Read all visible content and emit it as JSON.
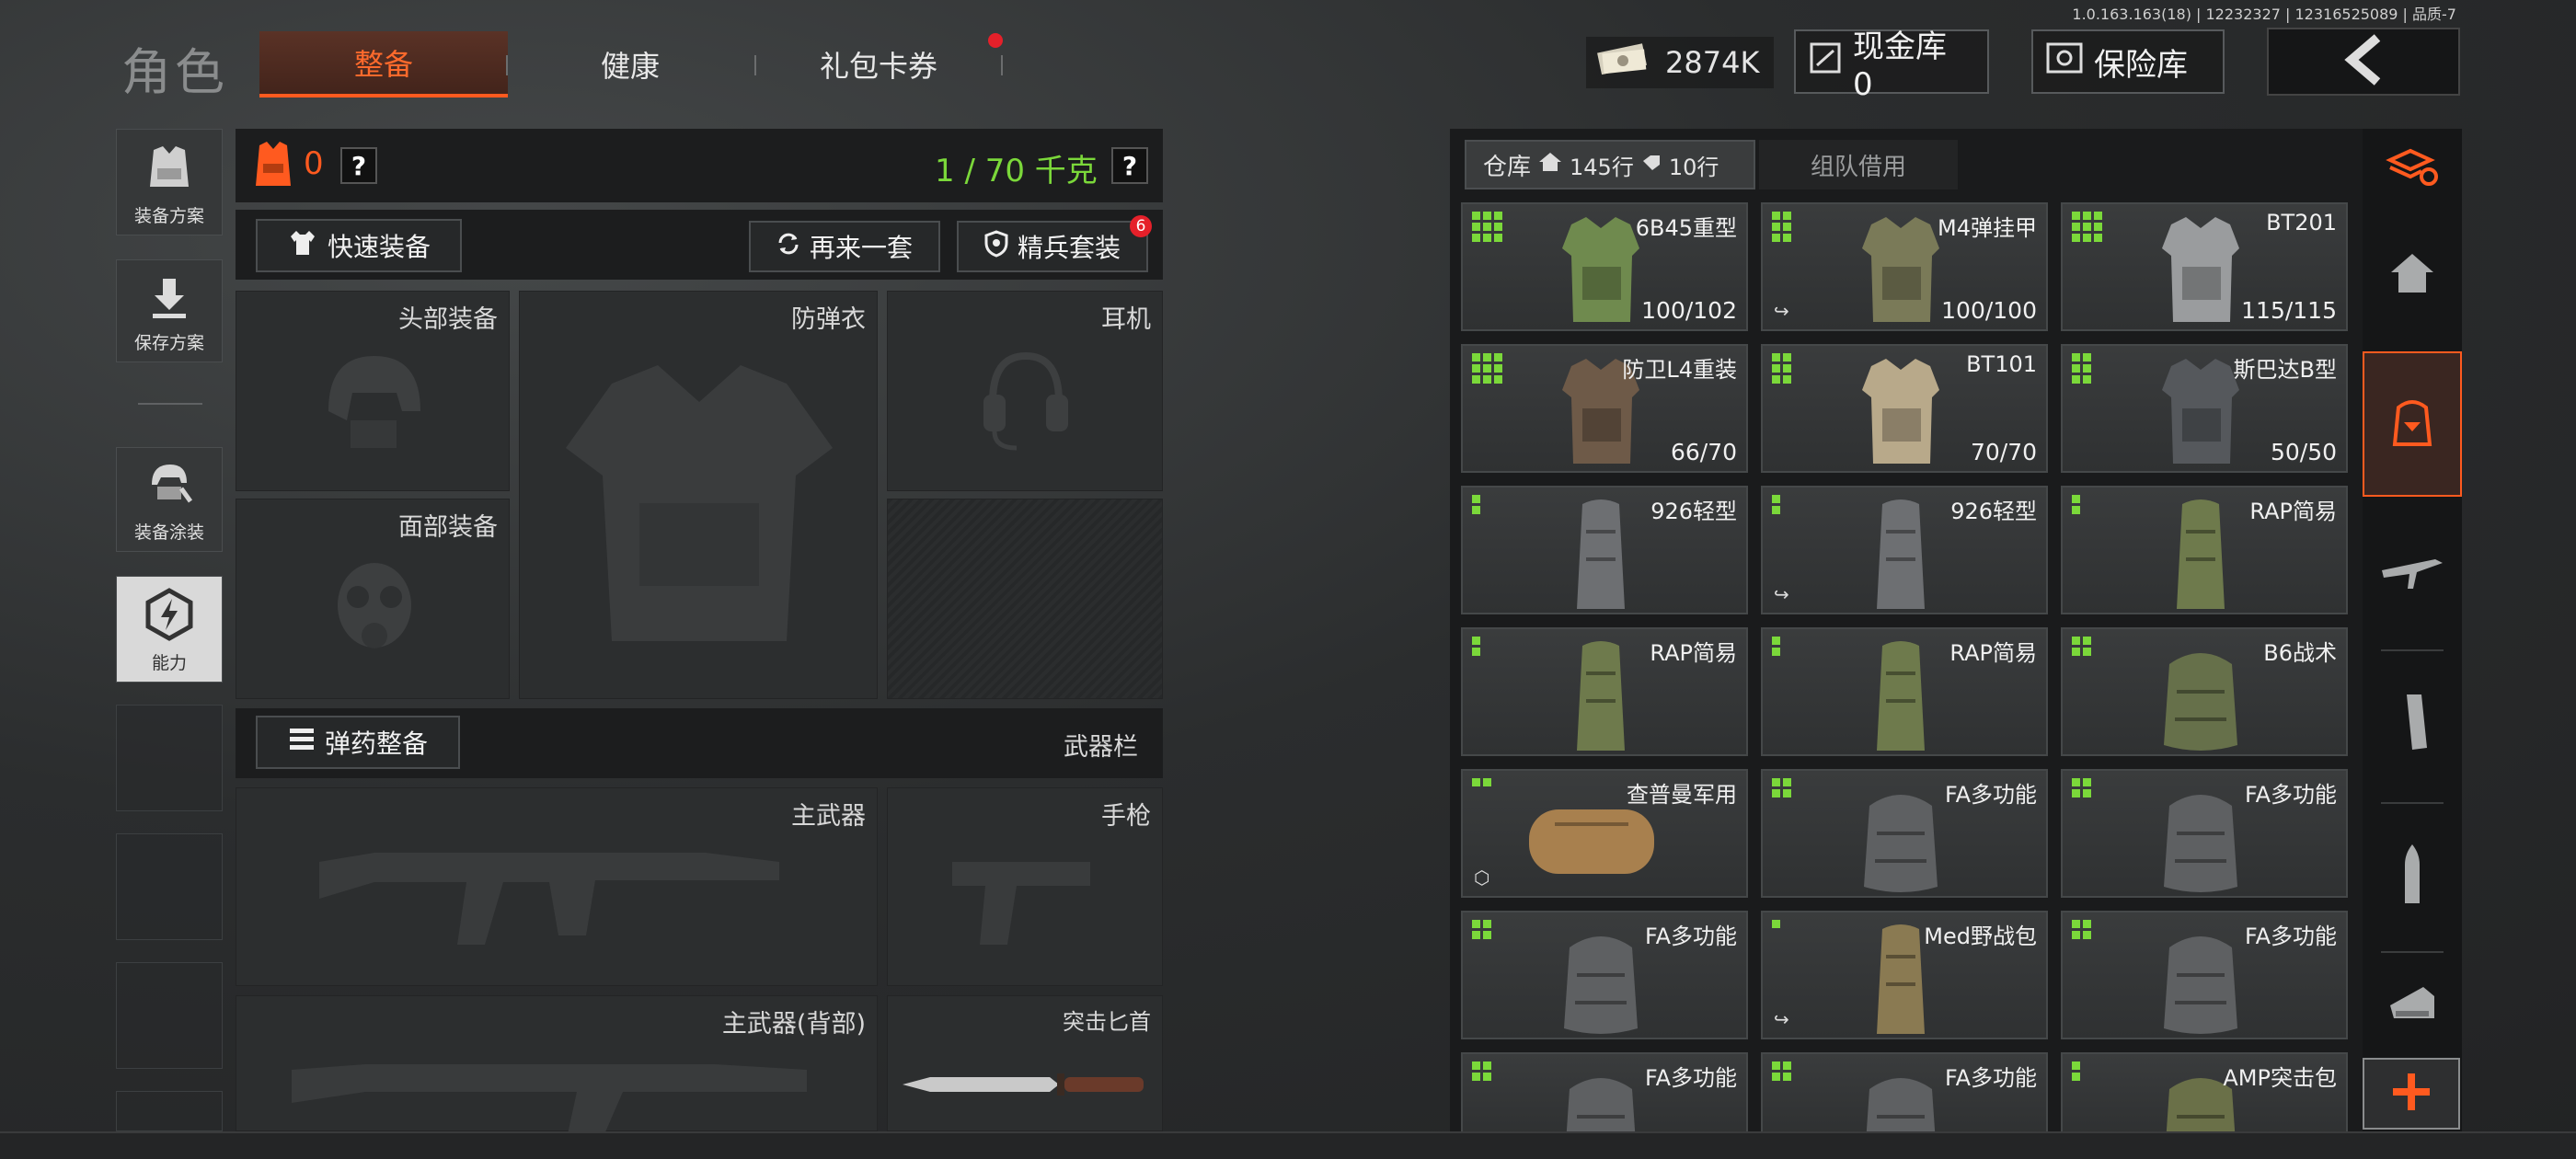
{
  "version": "1.0.163.163(18) | 12232327 | 12316525089 | 品质-7",
  "header": {
    "title": "角色",
    "tabs": [
      {
        "label": "整备",
        "active": true
      },
      {
        "label": "健康",
        "active": false
      },
      {
        "label": "礼包卡券",
        "active": false,
        "badge_dot": true
      }
    ],
    "money": "2874K",
    "cash_vault": "现金库 0",
    "safe_box": "保险库"
  },
  "sidebar": {
    "items": [
      {
        "label": "装备方案",
        "icon": "vest-icon"
      },
      {
        "label": "保存方案",
        "icon": "download-icon"
      },
      {
        "label": "装备涂装",
        "icon": "helmet-paint-icon"
      },
      {
        "label": "能力",
        "icon": "ability-icon"
      }
    ]
  },
  "loadout": {
    "armor_count": "0",
    "weight": "1 / 70 千克",
    "quick_equip": "快速装备",
    "redo_set": "再来一套",
    "elite_set": "精兵套装",
    "elite_badge": "6",
    "slots": {
      "head": "头部装备",
      "vest": "防弹衣",
      "ear": "耳机",
      "face": "面部装备",
      "main_weapon": "主武器",
      "pistol": "手枪",
      "main_back": "主武器(背部)",
      "knife": "突击匕首"
    },
    "ammo_equip": "弹药整备",
    "weapon_bar": "武器栏"
  },
  "inventory": {
    "tabs": {
      "warehouse": "仓库",
      "rows_home": "145行",
      "rows_tag": "10行",
      "team": "组队借用"
    },
    "items": [
      {
        "name": "6B45重型",
        "dur": "100/102",
        "grid": 9,
        "color": "#6f8a4e",
        "shape": "vest"
      },
      {
        "name": "M4弹挂甲",
        "dur": "100/100",
        "grid": 6,
        "color": "#7a7a58",
        "shape": "vest",
        "sub": "↪"
      },
      {
        "name": "BT201",
        "dur": "115/115",
        "grid": 9,
        "color": "#9a9c9e",
        "shape": "vest"
      },
      {
        "name": "防卫L4重装",
        "dur": "66/70",
        "grid": 9,
        "color": "#6e5a48",
        "shape": "vest"
      },
      {
        "name": "BT101",
        "dur": "70/70",
        "grid": 6,
        "color": "#b8a98a",
        "shape": "vest"
      },
      {
        "name": "斯巴达B型",
        "dur": "50/50",
        "grid": 6,
        "color": "#55585c",
        "shape": "vest"
      },
      {
        "name": "926轻型",
        "dur": "",
        "grid": 2,
        "color": "#6d6f72",
        "shape": "pack"
      },
      {
        "name": "926轻型",
        "dur": "",
        "grid": 2,
        "color": "#6d6f72",
        "shape": "pack",
        "sub": "↪"
      },
      {
        "name": "RAP简易",
        "dur": "",
        "grid": 2,
        "color": "#6e7a4c",
        "shape": "pack"
      },
      {
        "name": "RAP简易",
        "dur": "",
        "grid": 2,
        "color": "#6e7a4c",
        "shape": "pack"
      },
      {
        "name": "RAP简易",
        "dur": "",
        "grid": 2,
        "color": "#6e7a4c",
        "shape": "pack"
      },
      {
        "name": "B6战术",
        "dur": "",
        "grid": 4,
        "color": "#66704a",
        "shape": "bag"
      },
      {
        "name": "查普曼军用",
        "dur": "",
        "grid": 2,
        "color": "#a8804e",
        "shape": "duffel",
        "sub": "⬡"
      },
      {
        "name": "FA多功能",
        "dur": "",
        "grid": 4,
        "color": "#5e6062",
        "shape": "bag"
      },
      {
        "name": "FA多功能",
        "dur": "",
        "grid": 4,
        "color": "#5e6062",
        "shape": "bag"
      },
      {
        "name": "FA多功能",
        "dur": "",
        "grid": 4,
        "color": "#5e6062",
        "shape": "bag"
      },
      {
        "name": "Med野战包",
        "dur": "",
        "grid": 1,
        "color": "#8a7a52",
        "shape": "pack",
        "sub": "↪"
      },
      {
        "name": "FA多功能",
        "dur": "",
        "grid": 4,
        "color": "#5e6062",
        "shape": "bag"
      },
      {
        "name": "FA多功能",
        "dur": "",
        "grid": 4,
        "color": "#5e6062",
        "shape": "bag"
      },
      {
        "name": "FA多功能",
        "dur": "",
        "grid": 4,
        "color": "#5e6062",
        "shape": "bag"
      },
      {
        "name": "AMP突击包",
        "dur": "",
        "grid": 2,
        "color": "#6a7048",
        "shape": "bag"
      }
    ]
  },
  "colors": {
    "accent_orange": "#ff5a1f",
    "weight_green": "#7bd83a",
    "grid_green": "#7bd83a"
  }
}
